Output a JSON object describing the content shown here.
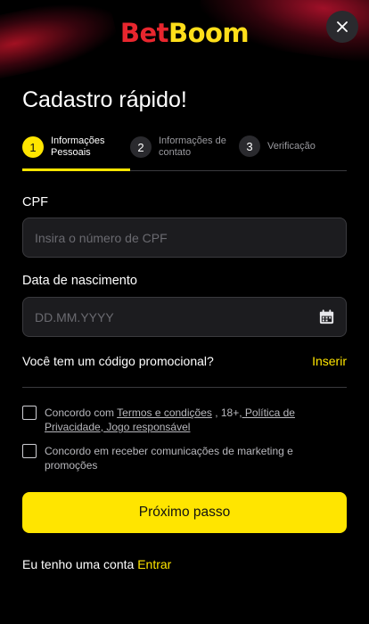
{
  "brand": {
    "part1": "Bet",
    "part2": "Boom",
    "colors": {
      "bet": "#e8262e",
      "boom": "#ffde1a"
    }
  },
  "header": {
    "close_icon": "close-icon"
  },
  "title": "Cadastro rápido!",
  "steps": [
    {
      "num": "1",
      "line1": "Informações",
      "line2": "Pessoais",
      "active": true
    },
    {
      "num": "2",
      "line1": "Informações de",
      "line2": "contato",
      "active": false
    },
    {
      "num": "3",
      "line1": "Verificação",
      "line2": "",
      "active": false
    }
  ],
  "form": {
    "cpf": {
      "label": "CPF",
      "placeholder": "Insira o número de CPF",
      "value": ""
    },
    "birth": {
      "label": "Data de nascimento",
      "placeholder": "DD.MM.YYYY",
      "value": "",
      "icon": "calendar-icon"
    }
  },
  "promo": {
    "question": "Você tem um código promocional?",
    "link": "Inserir"
  },
  "consents": {
    "terms": {
      "prefix": "Concordo com ",
      "terms_link": "Termos e condições",
      "middle": " , 18+,",
      "privacy_link": " Política de Privacidade",
      "sep": ",",
      "responsible_link": " Jogo responsável",
      "checked": false
    },
    "marketing": {
      "text": "Concordo em receber comunicações de marketing e promoções",
      "checked": false
    }
  },
  "actions": {
    "next": "Próximo passo"
  },
  "login": {
    "prefix": "Eu tenho uma conta ",
    "link": "Entrar"
  },
  "theme": {
    "accent": "#ffe500",
    "background": "#000000",
    "field_bg": "#1c1c1f"
  }
}
